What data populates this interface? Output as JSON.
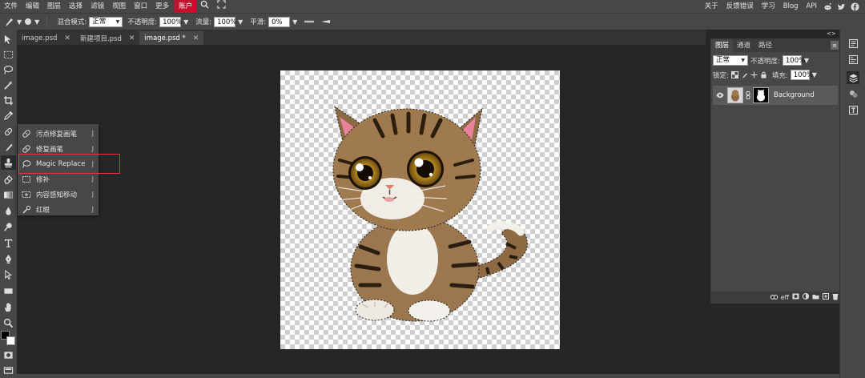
{
  "menubar": {
    "items": [
      "文件",
      "编辑",
      "图层",
      "选择",
      "滤镜",
      "视图",
      "窗口",
      "更多"
    ],
    "account": "账户",
    "right_items": [
      "关于",
      "反馈错误",
      "学习",
      "Blog",
      "API"
    ],
    "accent_color": "#c8102e"
  },
  "options": {
    "blend_label": "混合模式:",
    "blend_value": "正常",
    "opacity_label": "不透明度:",
    "opacity_value": "100%",
    "flow_label": "流量:",
    "flow_value": "100%",
    "smooth_label": "平滑:",
    "smooth_value": "0%"
  },
  "tabs": [
    {
      "label": "image.psd",
      "active": false
    },
    {
      "label": "新建项目.psd",
      "active": false
    },
    {
      "label": "image.psd *",
      "active": true
    }
  ],
  "tab_close": "✕",
  "flyout": {
    "items": [
      {
        "label": "污点修复画笔",
        "key": "J",
        "icon": "spot-heal-icon"
      },
      {
        "label": "修复画笔",
        "key": "J",
        "icon": "healing-brush-icon"
      },
      {
        "label": "Magic Replace",
        "key": "J",
        "icon": "lasso-magic-icon"
      },
      {
        "label": "修补",
        "key": "J",
        "icon": "patch-icon"
      },
      {
        "label": "内容感知移动",
        "key": "J",
        "icon": "content-move-icon"
      },
      {
        "label": "红眼",
        "key": "J",
        "icon": "red-eye-icon"
      }
    ],
    "highlight_color": "#e0353c"
  },
  "layers_panel": {
    "tabs": [
      "图层",
      "通道",
      "路径"
    ],
    "blend_value": "正常",
    "opacity_label": "不透明度:",
    "opacity_value": "100%",
    "lock_label": "锁定:",
    "fill_label": "填充:",
    "fill_value": "100%",
    "layer_name": "Background",
    "footer_icons": [
      "link-icon",
      "fx-icon",
      "mask-icon",
      "adjustment-icon",
      "folder-icon",
      "new-layer-icon",
      "trash-icon"
    ],
    "fx_label": "eff"
  },
  "collapse": "<>"
}
